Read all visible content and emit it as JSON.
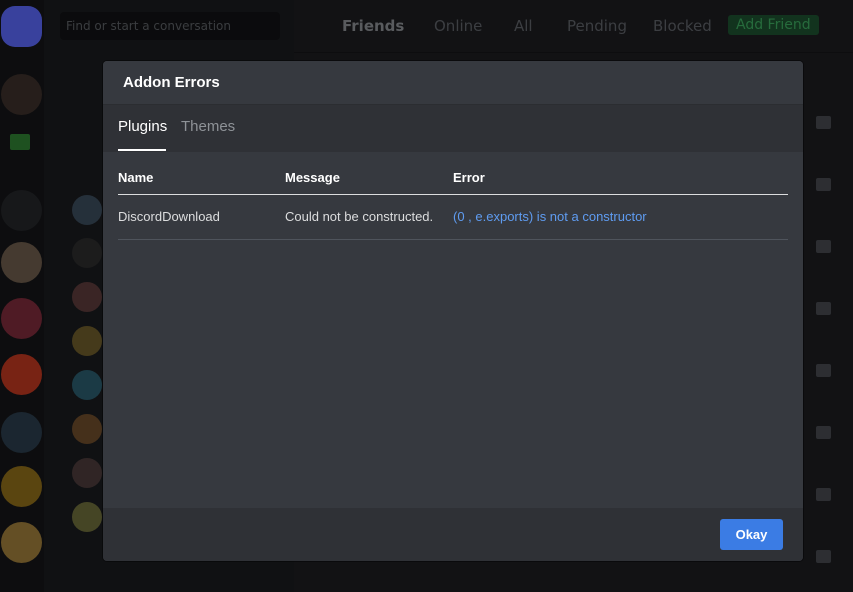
{
  "sidebar": {
    "search_placeholder": "Find or start a conversation"
  },
  "topbar": {
    "friends": "Friends",
    "online": "Online",
    "all": "All",
    "pending": "Pending",
    "blocked": "Blocked",
    "add_friend": "Add Friend"
  },
  "modal": {
    "title": "Addon Errors",
    "tabs": [
      {
        "label": "Plugins",
        "active": true
      },
      {
        "label": "Themes",
        "active": false
      }
    ],
    "columns": [
      "Name",
      "Message",
      "Error"
    ],
    "rows": [
      {
        "name": "DiscordDownload",
        "message": "Could not be constructed.",
        "error": "(0 , e.exports) is not a constructor"
      }
    ],
    "okay_label": "Okay"
  },
  "colors": {
    "accent": "#3b7ce4",
    "link": "#5f9cf1",
    "modal_bg": "#36393f",
    "modal_bar": "#2f3136"
  }
}
